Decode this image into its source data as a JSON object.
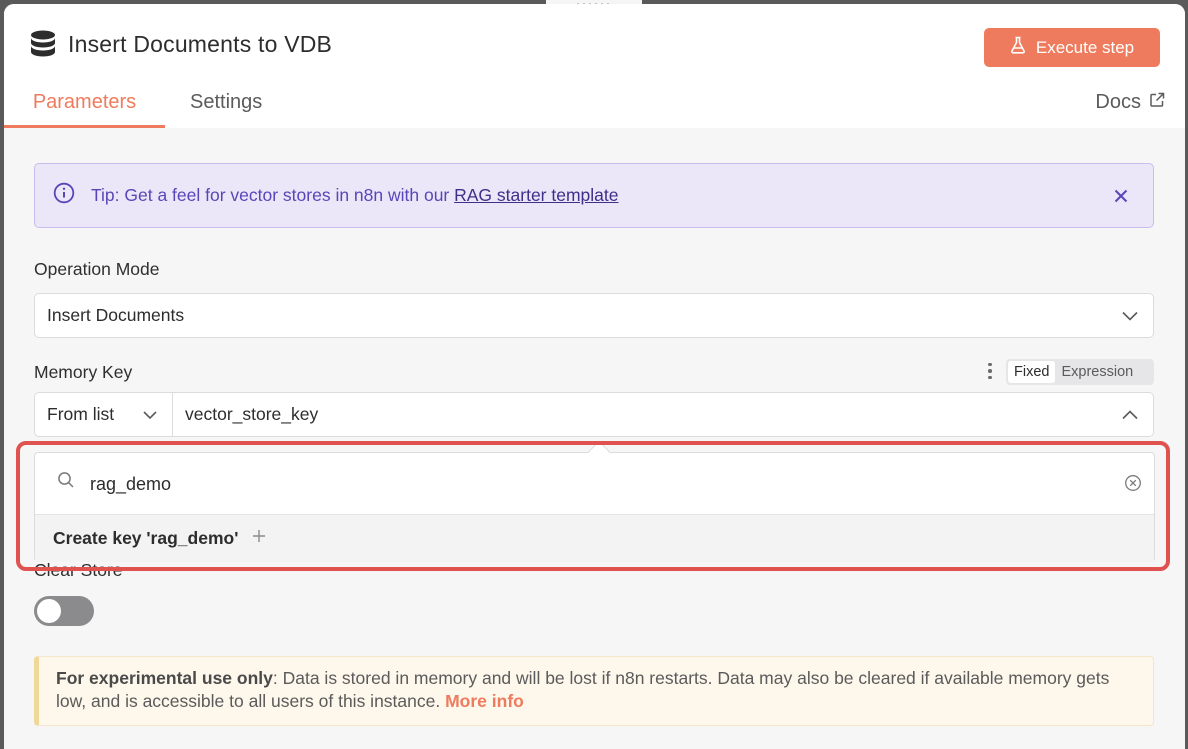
{
  "header": {
    "title": "Insert Documents to VDB",
    "execute_label": "Execute step",
    "title_icon": "database-icon"
  },
  "tabs": [
    {
      "label": "Parameters",
      "active": true
    },
    {
      "label": "Settings",
      "active": false
    },
    {
      "label": "Docs",
      "active": false
    }
  ],
  "tip": {
    "text": "Tip: Get a feel for vector stores in n8n with our ",
    "link": "RAG starter template"
  },
  "operation_mode": {
    "label": "Operation Mode",
    "value": "Insert Documents"
  },
  "memory_key": {
    "label": "Memory Key",
    "toggle_fixed": "Fixed",
    "toggle_expression": "Expression",
    "mode_value": "From list",
    "key_value": "vector_store_key"
  },
  "dropdown": {
    "search_value": "rag_demo",
    "create_label": "Create key 'rag_demo'"
  },
  "clear_store": {
    "label": "Clear Store",
    "enabled": false
  },
  "warning": {
    "bold": "For experimental use only",
    "text": ": Data is stored in memory and will be lost if n8n restarts. Data may also be cleared if available memory gets low, and is accessible to all users of this instance. ",
    "link": "More info"
  },
  "colors": {
    "accent": "#ee7b5d",
    "tip_text": "#5a45b8",
    "highlight": "#e0524f"
  }
}
